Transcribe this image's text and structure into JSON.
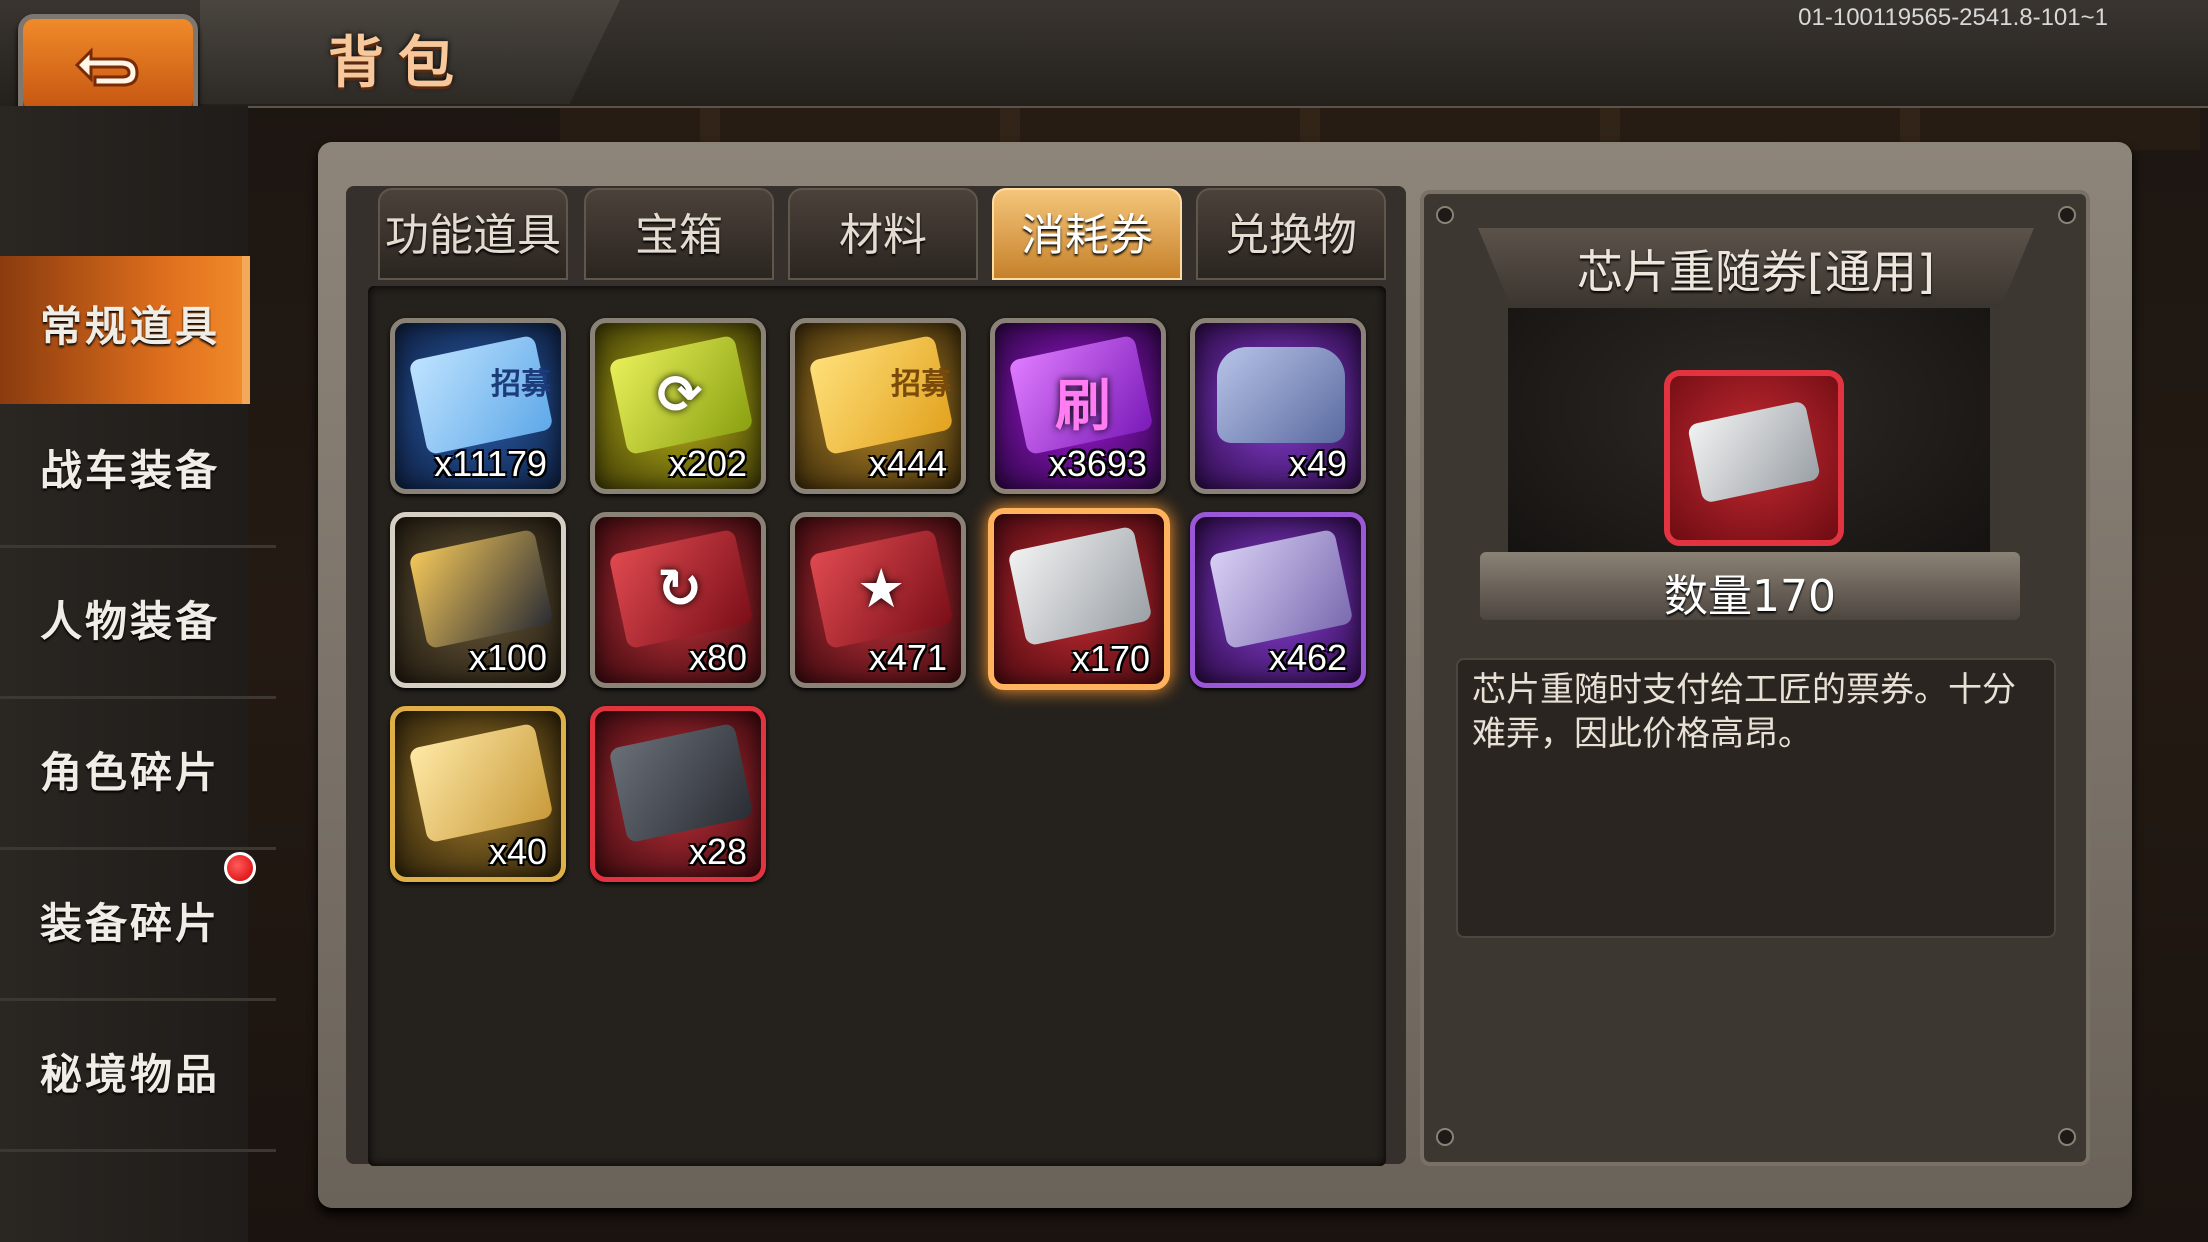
{
  "header": {
    "title": "背包",
    "server_id": "01-100119565-2541.8-101~1"
  },
  "sidebar": {
    "items": [
      {
        "label": "常规道具",
        "active": true
      },
      {
        "label": "战车装备",
        "active": false
      },
      {
        "label": "人物装备",
        "active": false
      },
      {
        "label": "角色碎片",
        "active": false
      },
      {
        "label": "装备碎片",
        "active": false,
        "has_notification": true
      },
      {
        "label": "秘境物品",
        "active": false
      }
    ]
  },
  "tabs": [
    {
      "label": "功能道具",
      "active": false
    },
    {
      "label": "宝箱",
      "active": false
    },
    {
      "label": "材料",
      "active": false
    },
    {
      "label": "消耗券",
      "active": true
    },
    {
      "label": "兑换物",
      "active": false
    }
  ],
  "items": [
    {
      "count": "x11179",
      "icon": "recruit-ticket-blue-icon",
      "art_text": "招募"
    },
    {
      "count": "x202",
      "icon": "refresh-ticket-green-icon"
    },
    {
      "count": "x444",
      "icon": "recruit-ticket-gold-icon",
      "art_text": "招募"
    },
    {
      "count": "x3693",
      "icon": "reroll-ticket-purple-icon",
      "art_text": "刷"
    },
    {
      "count": "x49",
      "icon": "chest-plate-icon"
    },
    {
      "count": "x100",
      "icon": "gold-armor-box-icon"
    },
    {
      "count": "x80",
      "icon": "red-rotate-ticket-icon"
    },
    {
      "count": "x471",
      "icon": "red-star-ticket-icon"
    },
    {
      "count": "x170",
      "icon": "chip-ticket-red-icon",
      "selected": true
    },
    {
      "count": "x462",
      "icon": "chip-ticket-purple-icon"
    },
    {
      "count": "x40",
      "icon": "chip-ticket-gold-icon"
    },
    {
      "count": "x28",
      "icon": "chip-ticket-dark-red-icon"
    }
  ],
  "detail": {
    "name": "芯片重随券[通用]",
    "quantity_text": "数量170",
    "description": "芯片重随时支付给工匠的票券。十分难弄，因此价格高昂。"
  },
  "colors": {
    "accent_orange": "#f08a2a",
    "selected_glow": "#ffb35c",
    "frame": "#8e857a"
  }
}
